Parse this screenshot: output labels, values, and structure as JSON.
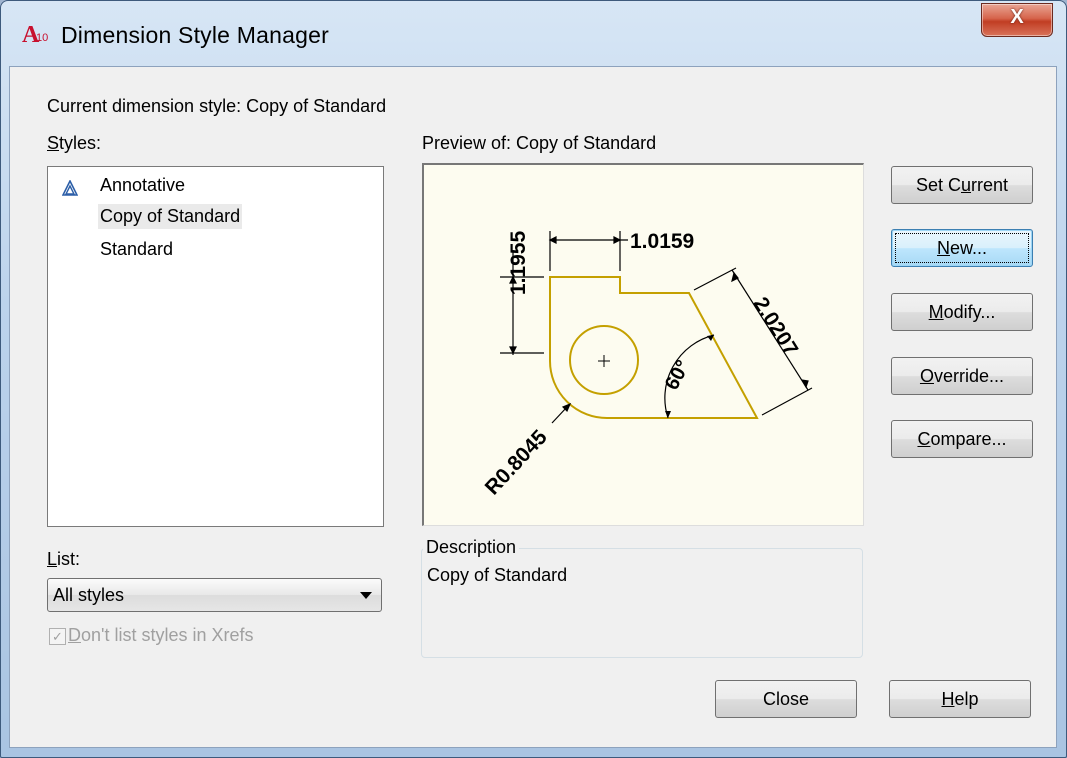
{
  "window": {
    "title": "Dimension Style Manager",
    "app_icon_text": "A",
    "app_icon_version": "10",
    "close_glyph": "X"
  },
  "current_style": {
    "label": "Current dimension style: Copy of Standard"
  },
  "styles": {
    "label_prefix": "S",
    "label_rest": "tyles:",
    "items": [
      {
        "label": "Annotative",
        "icon": "annotative-icon"
      },
      {
        "label": "Copy of Standard",
        "selected": true
      },
      {
        "label": "Standard"
      }
    ]
  },
  "preview": {
    "label": "Preview of: Copy of Standard",
    "dims": {
      "vertical": "1.1955",
      "horizontal": "1.0159",
      "aligned": "2.0207",
      "angle": "60°",
      "radius": "R0.8045"
    },
    "colors": {
      "outline": "#c4a000",
      "dims": "#000000",
      "background": "#fdfcf0"
    }
  },
  "list_filter": {
    "label_prefix": "L",
    "label_rest": "ist:",
    "selected": "All styles"
  },
  "xref_checkbox": {
    "checked": true,
    "label_pre": "D",
    "label_rest": "on't list styles in Xrefs"
  },
  "description": {
    "title": "Description",
    "text": "Copy of Standard"
  },
  "buttons": {
    "set_current": {
      "pre": "Set C",
      "u": "u",
      "post": "rrent"
    },
    "new": {
      "pre": "",
      "u": "N",
      "post": "ew..."
    },
    "modify": {
      "pre": "",
      "u": "M",
      "post": "odify..."
    },
    "override": {
      "pre": "",
      "u": "O",
      "post": "verride..."
    },
    "compare": {
      "pre": "",
      "u": "C",
      "post": "ompare..."
    },
    "close": {
      "label": "Close"
    },
    "help": {
      "pre": "",
      "u": "H",
      "post": "elp"
    }
  }
}
